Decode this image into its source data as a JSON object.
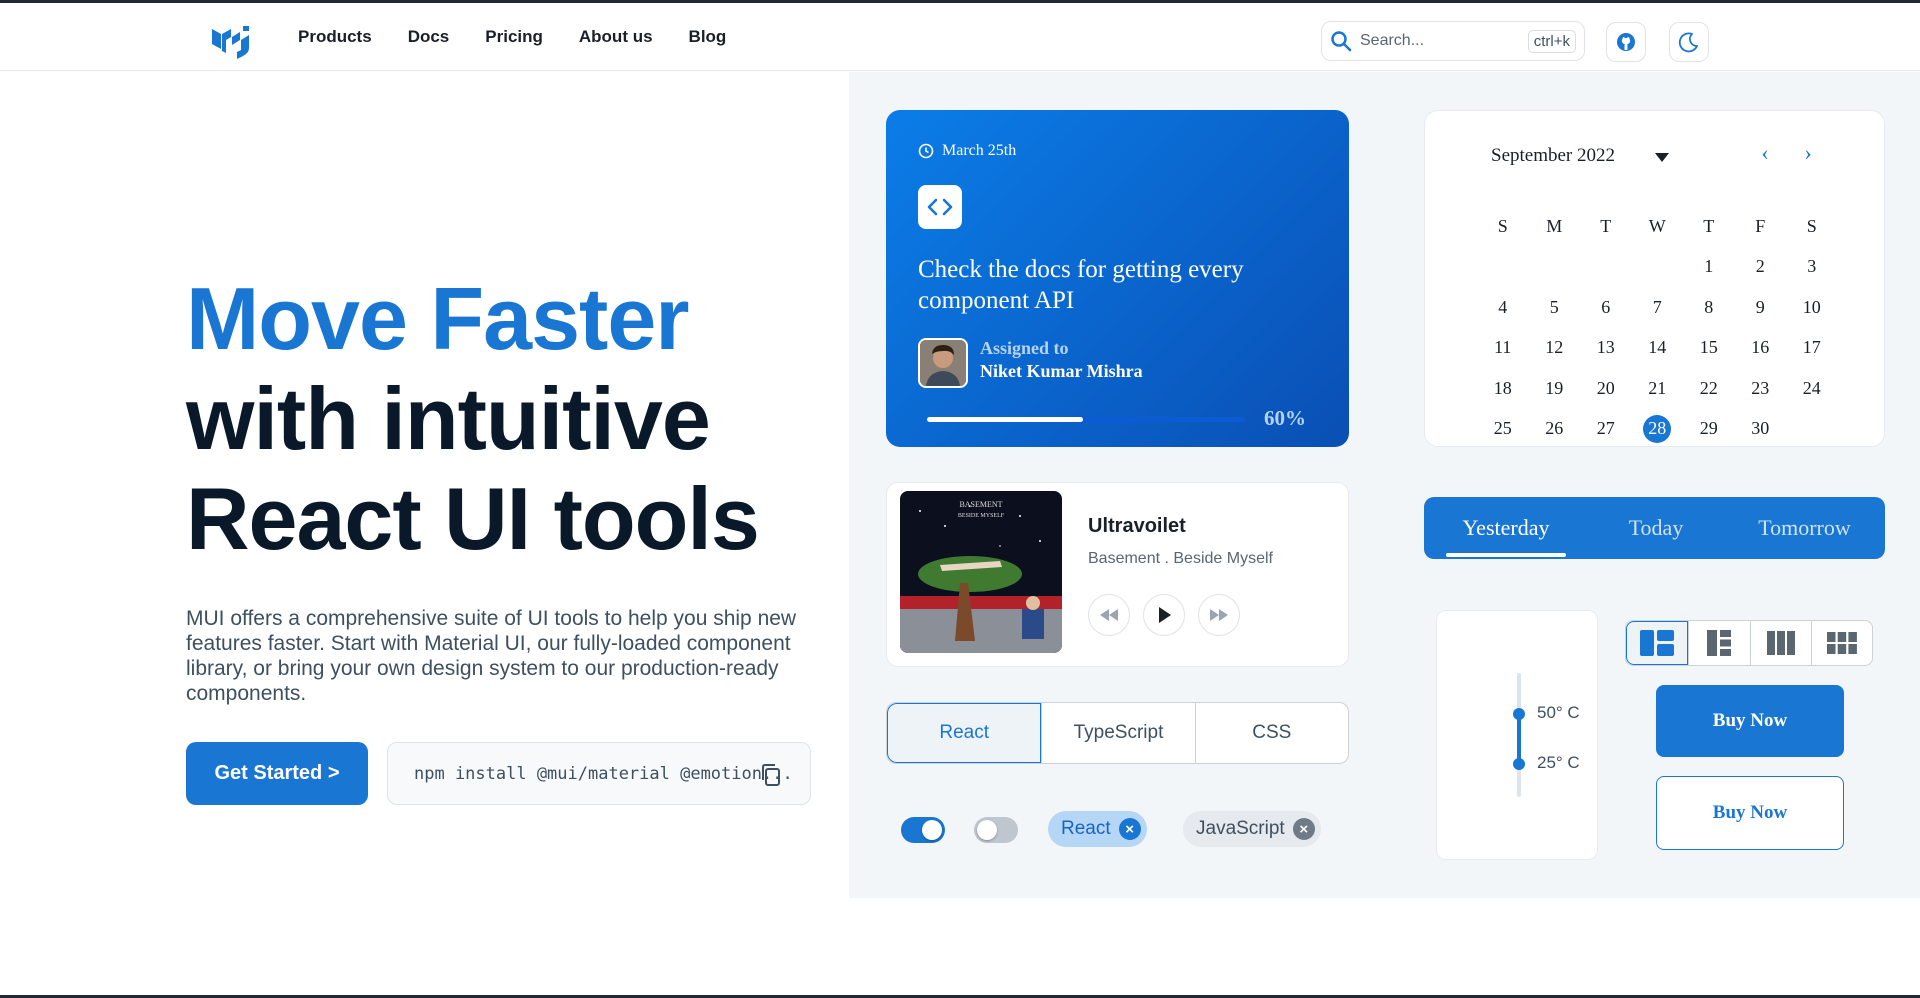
{
  "nav": {
    "items": [
      "Products",
      "Docs",
      "Pricing",
      "About us",
      "Blog"
    ],
    "search_placeholder": "Search...",
    "search_shortcut": "ctrl+k"
  },
  "hero": {
    "line1": "Move Faster",
    "line2": "with intuitive",
    "line3": "React UI tools",
    "description": "MUI offers a comprehensive suite of UI tools to help you ship new features faster. Start with Material UI, our fully-loaded component library, or bring your own design system to our production-ready components.",
    "cta_label": "Get Started >",
    "install_command": "npm install @mui/material @emotion..."
  },
  "task_card": {
    "date": "March 25th",
    "title": "Check the docs for getting every component API",
    "assigned_label": "Assigned to",
    "assignee": "Niket Kumar Mishra",
    "progress_text": "60%",
    "progress_value": 0.49
  },
  "player": {
    "title": "Ultravoilet",
    "subtitle": "Basement . Beside Myself",
    "album_text_1": "BASEMENT",
    "album_text_2": "BESIDE MYSELF"
  },
  "lang_tabs": [
    "React",
    "TypeScript",
    "CSS"
  ],
  "chips": [
    {
      "label": "React"
    },
    {
      "label": "JavaScript"
    }
  ],
  "calendar": {
    "month_label": "September 2022",
    "weekdays": [
      "S",
      "M",
      "T",
      "W",
      "T",
      "F",
      "S"
    ],
    "leading_blanks": 4,
    "days": 30,
    "selected_day": 28
  },
  "day_tabs": [
    "Yesterday",
    "Today",
    "Tomorrow"
  ],
  "temperature": {
    "high_label": "50° C",
    "low_label": "25° C"
  },
  "buttons": {
    "buy_contained": "Buy Now",
    "buy_outlined": "Buy Now"
  },
  "colors": {
    "primary": "#1976d2",
    "text_dark": "#0a1929",
    "text_muted": "#3e5060"
  }
}
